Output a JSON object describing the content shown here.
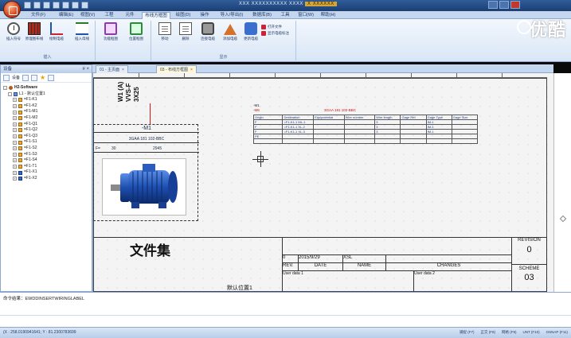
{
  "window": {
    "title_prefix": "XXX XXXXXXXXXX XXXX",
    "title_highlight": "X XXXXXX"
  },
  "ribbon": {
    "tabs": [
      "文件(F)",
      "编辑(E)",
      "视图(V)",
      "工程",
      "元件",
      "布线方框图",
      "绘图(D)",
      "操作",
      "导入/导出(I)",
      "数据库(B)",
      "工具",
      "窗口(W)",
      "帮助(H)"
    ],
    "groups": [
      {
        "label": "插入",
        "buttons": [
          "插入符号",
          "原理图布线",
          "绘制电缆",
          "插入母线",
          "绘制导线"
        ]
      },
      {
        "label": "",
        "buttons": [
          "功能框图",
          "位置框图"
        ]
      },
      {
        "label": "显示",
        "buttons": [
          "移动",
          "删除",
          "连接电缆",
          "添加电缆",
          "更新电缆"
        ]
      }
    ],
    "small_items": [
      "打开文件",
      "显示电缆标注"
    ]
  },
  "watermark": "优酷",
  "left_panel": {
    "title": "设备",
    "pin": "# ×",
    "toolbar_label": "设备",
    "tree": [
      {
        "label": "H2-Software",
        "level": 0,
        "icon": "top",
        "exp": "-"
      },
      {
        "label": "L1 - 默认位置1",
        "level": 1,
        "icon": "pc",
        "exp": "-"
      },
      {
        "label": "=F1-K1",
        "level": 2,
        "icon": "comp",
        "exp": "+"
      },
      {
        "label": "=F1-K2",
        "level": 2,
        "icon": "comp",
        "exp": "+"
      },
      {
        "label": "=F1-M1",
        "level": 2,
        "icon": "comp",
        "exp": "+"
      },
      {
        "label": "=F1-M2",
        "level": 2,
        "icon": "comp",
        "exp": "+"
      },
      {
        "label": "=F1-Q1",
        "level": 2,
        "icon": "comp",
        "exp": "+"
      },
      {
        "label": "=F1-Q2",
        "level": 2,
        "icon": "comp",
        "exp": "+"
      },
      {
        "label": "=F1-Q3",
        "level": 2,
        "icon": "comp",
        "exp": "+"
      },
      {
        "label": "=F1-S1",
        "level": 2,
        "icon": "comp",
        "exp": "+"
      },
      {
        "label": "=F1-S2",
        "level": 2,
        "icon": "comp",
        "exp": "+"
      },
      {
        "label": "=F1-S3",
        "level": 2,
        "icon": "comp",
        "exp": "+"
      },
      {
        "label": "=F1-S4",
        "level": 2,
        "icon": "comp",
        "exp": "+"
      },
      {
        "label": "=F1-T1",
        "level": 2,
        "icon": "comp",
        "exp": "+"
      },
      {
        "label": "=F1-X1",
        "level": 2,
        "icon": "blue",
        "exp": "+"
      },
      {
        "label": "=F1-X2",
        "level": 2,
        "icon": "blue",
        "exp": "+"
      }
    ]
  },
  "doc_tabs": [
    {
      "label": "01 - 主页面",
      "active": false
    },
    {
      "label": "03 - 布线方框图",
      "active": true
    }
  ],
  "drawing": {
    "vertical_texts": [
      "W1 (A)",
      "VVS-F",
      "3X25"
    ],
    "device": {
      "head": "-M1",
      "part": "3GAA 181 102-BBC",
      "row_label": "F=",
      "row_value": "30",
      "row_value2": "2945"
    },
    "table_tag": "-M1",
    "table_sub": "-M8",
    "table_title": "3GAA 181 102-BBC",
    "param_headers": [
      "Origin",
      "Destination",
      "Equipotential",
      "Wire number",
      "Wire length",
      "Gage Ref",
      "Gage Type",
      "Gage Size"
    ],
    "param_rows": [
      [
        "F",
        "=F1-K1-1 ML-1",
        "",
        "",
        "3",
        "",
        "IM-1",
        ""
      ],
      [
        "F",
        "=F1-K1-1 XL-2",
        "",
        "",
        "3",
        "",
        "IM-1",
        ""
      ],
      [
        "F",
        "=F1-K1-1 XL-3",
        "",
        "",
        "3",
        "",
        "IM-1",
        ""
      ],
      [
        "PE",
        "",
        "",
        "",
        "",
        "",
        "",
        ""
      ],
      [
        "",
        "",
        "",
        "",
        "",
        "",
        "",
        ""
      ]
    ],
    "title_block": {
      "main_title": "文件集",
      "rev_no": "0",
      "date": "2015/9/29",
      "name": "XSL",
      "rev_label": "REV.",
      "date_label": "DATE",
      "name_label": "NAME",
      "changes_label": "CHANGES",
      "user_data_1": "User data 1",
      "user_data_2": "User data 2",
      "revision_label": "REVISION",
      "revision_value": "0",
      "scheme_label": "SCHEME",
      "scheme_value": "03",
      "location": "默认位置1"
    }
  },
  "command": {
    "line": "命令结果：EWDDINSERTWIRINGLABEL"
  },
  "status": {
    "coords": "(X : 258.0190941641; Y : 81.2300783699",
    "items": [
      "捕捉 (F7)",
      "正交 (F8)",
      "网格 (F9)",
      "UNT (F10)",
      "OSNAP (F11)"
    ]
  }
}
